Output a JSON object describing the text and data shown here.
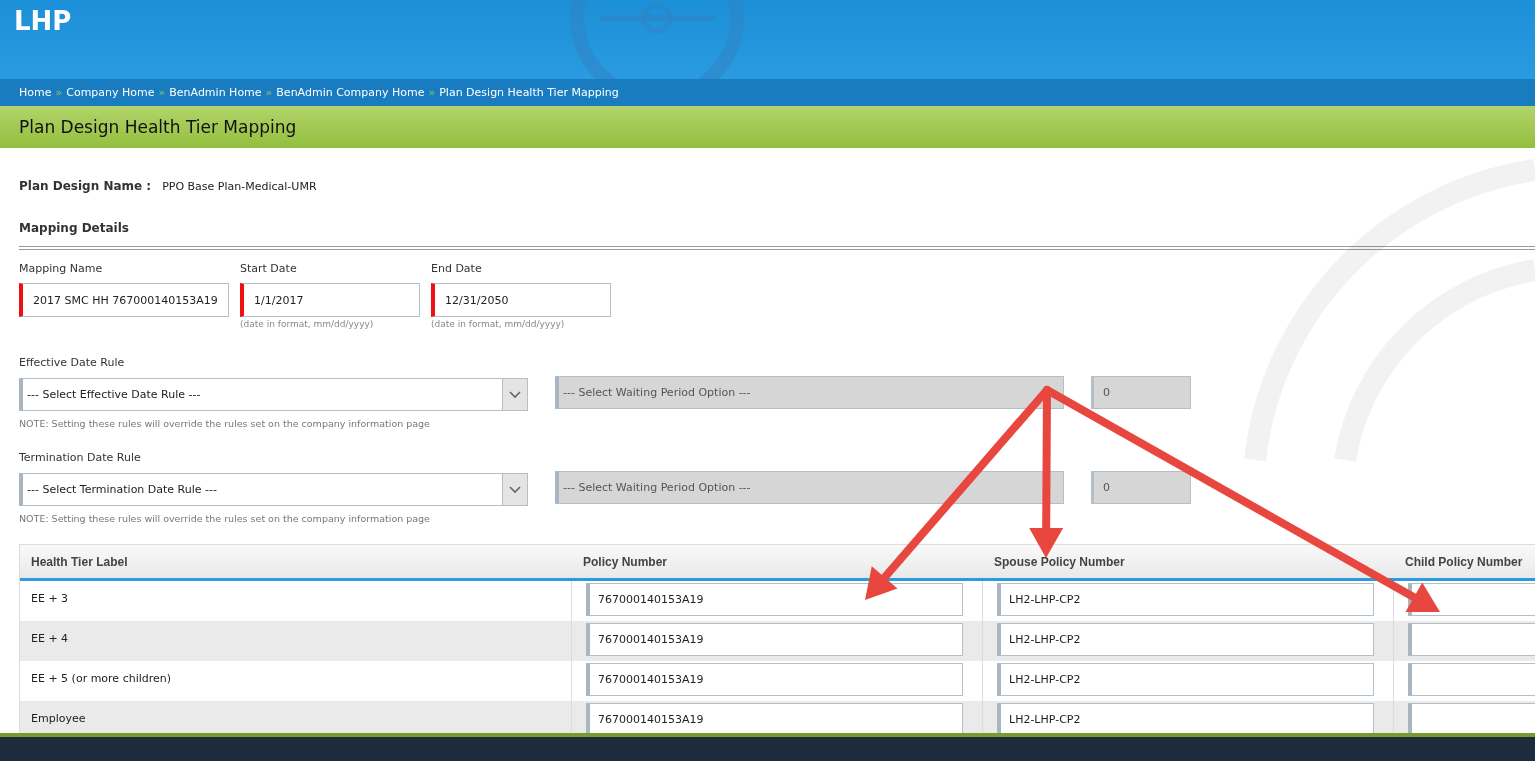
{
  "header": {
    "logo": "LHP"
  },
  "breadcrumb": [
    {
      "label": "Home",
      "separator": "»"
    },
    {
      "label": "Company Home",
      "separator": "»"
    },
    {
      "label": "BenAdmin Home",
      "separator": "»"
    },
    {
      "label": "BenAdmin Company Home",
      "separator": "»"
    },
    {
      "label": "Plan Design Health Tier Mapping"
    }
  ],
  "page_title": "Plan Design Health Tier Mapping",
  "plan_design": {
    "label": "Plan Design Name :",
    "value": "PPO Base Plan-Medical-UMR"
  },
  "section_title": "Mapping Details",
  "mapping_fields": [
    {
      "label": "Mapping Name",
      "value": "2017 SMC HH 767000140153A19",
      "required": true
    },
    {
      "label": "Start Date",
      "value": "1/1/2017",
      "required": true,
      "hint": "(date in format, mm/dd/yyyy)"
    },
    {
      "label": "End Date",
      "value": "12/31/2050",
      "required": true,
      "hint": "(date in format, mm/dd/yyyy)"
    }
  ],
  "rules": [
    {
      "label": "Effective Date Rule",
      "select": {
        "value": "--- Select Effective Date Rule ---",
        "disabled": false
      },
      "waiting_period": {
        "value": "--- Select Waiting Period Option ---",
        "disabled": true
      },
      "days": {
        "value": "0",
        "disabled": true
      },
      "note": "NOTE: Setting these rules will override the rules set on the company information page"
    },
    {
      "label": "Termination Date Rule",
      "select": {
        "value": "--- Select Termination Date Rule ---",
        "disabled": false
      },
      "waiting_period": {
        "value": "--- Select Waiting Period Option ---",
        "disabled": true
      },
      "days": {
        "value": "0",
        "disabled": true
      },
      "note": "NOTE: Setting these rules will override the rules set on the company information page"
    }
  ],
  "table": {
    "columns": [
      "Health Tier Label",
      "Policy Number",
      "Spouse Policy Number",
      "Child Policy Number"
    ],
    "rows": [
      {
        "label": "EE + 3",
        "policy_number": "767000140153A19",
        "spouse_policy_number": "LH2-LHP-CP2"
      },
      {
        "label": "EE + 4",
        "policy_number": "767000140153A19",
        "spouse_policy_number": "LH2-LHP-CP2"
      },
      {
        "label": "EE + 5 (or more children)",
        "policy_number": "767000140153A19",
        "spouse_policy_number": "LH2-LHP-CP2"
      },
      {
        "label": "Employee",
        "policy_number": "767000140153A19",
        "spouse_policy_number": "LH2-LHP-CP2"
      }
    ]
  }
}
